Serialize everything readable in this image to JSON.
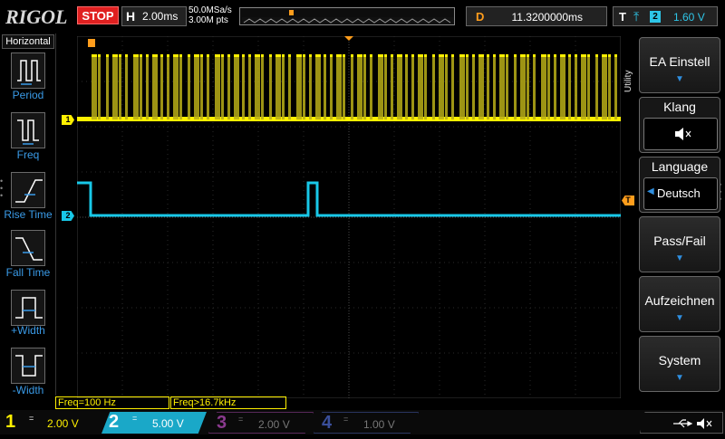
{
  "brand": "RIGOL",
  "run_state": "STOP",
  "horizontal": {
    "label": "H",
    "timebase": "2.00ms"
  },
  "acquisition": {
    "sample_rate": "50.0MSa/s",
    "points": "3.00M pts"
  },
  "trigger_position": {
    "label": "D",
    "value": "11.3200000ms"
  },
  "trigger": {
    "label": "T",
    "source": "2",
    "level": "1.60 V"
  },
  "left_panel": {
    "title": "Horizontal",
    "items": [
      {
        "label": "Period",
        "icon": "period-icon"
      },
      {
        "label": "Freq",
        "icon": "freq-icon"
      },
      {
        "label": "Rise Time",
        "icon": "rise-time-icon"
      },
      {
        "label": "Fall Time",
        "icon": "fall-time-icon"
      },
      {
        "label": "+Width",
        "icon": "positive-width-icon"
      },
      {
        "label": "-Width",
        "icon": "negative-width-icon"
      }
    ]
  },
  "menu": {
    "title": "Utility",
    "items": [
      {
        "label": "EA Einstell"
      },
      {
        "label": "Klang",
        "value_icon": "speaker-mute-icon"
      },
      {
        "label": "Language",
        "value": "Deutsch"
      },
      {
        "label": "Pass/Fail"
      },
      {
        "label": "Aufzeichnen"
      },
      {
        "label": "System"
      }
    ]
  },
  "measurements": [
    {
      "text": "Freq=100 Hz"
    },
    {
      "text": "Freq>16.7kHz"
    }
  ],
  "channels": [
    {
      "num": "1",
      "coupling": "=",
      "scale": "2.00 V",
      "color": "#fff000"
    },
    {
      "num": "2",
      "coupling": "=",
      "scale": "5.00 V",
      "color": "#1aa8c8"
    },
    {
      "num": "3",
      "coupling": "=",
      "scale": "2.00 V",
      "color": "#8a3a8e"
    },
    {
      "num": "4",
      "coupling": "=",
      "scale": "1.00 V",
      "color": "#3a4f9a"
    }
  ],
  "waveform_markers": {
    "ch1": "1",
    "ch2": "2"
  },
  "status_icons": [
    "usb-icon",
    "speaker-mute-icon"
  ],
  "colors": {
    "ch1": "#fff000",
    "ch2": "#18c8e8",
    "trigger": "#ff9d1c",
    "accent": "#2f8fe0"
  }
}
